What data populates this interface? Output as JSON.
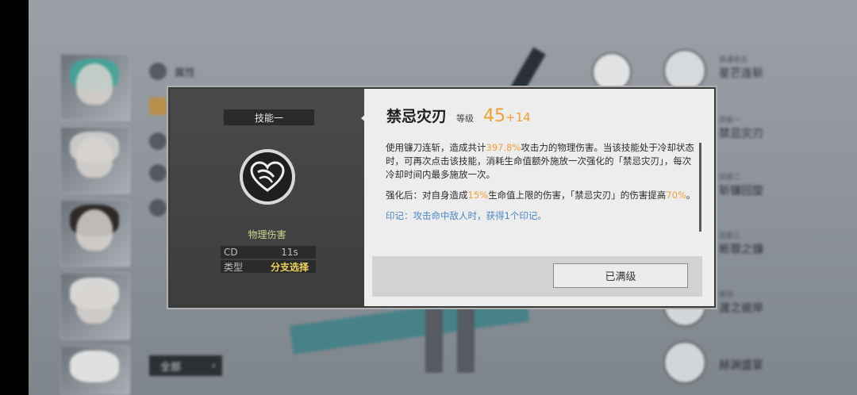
{
  "background": {
    "side_menu": [
      "属性",
      "",
      "",
      "",
      ""
    ],
    "all_button": "全部",
    "right_items": [
      {
        "tier": "普通攻击",
        "name": "星芒连斩"
      },
      {
        "tier": "技能一",
        "name": "禁忌灾刃"
      },
      {
        "tier": "技能二",
        "name": "斩镰回旋"
      },
      {
        "tier": "技能三",
        "name": "断罪之镰"
      },
      {
        "tier": "被动",
        "name": "渡之彼岸"
      },
      {
        "tier": "",
        "name": "赫渊盛宴"
      }
    ]
  },
  "modal": {
    "skill_slot": "技能一",
    "damage_type": "物理伤害",
    "stats": [
      {
        "key": "CD",
        "value": "11s"
      },
      {
        "key": "类型",
        "value": "分支选择"
      }
    ],
    "skill_name": "禁忌灾刃",
    "level_label": "等级",
    "level_base": "45",
    "level_bonus": "+14",
    "desc1": {
      "pre": "使用镰刀连斩，造成共计",
      "hl": "397.8%",
      "post": "攻击力的物理伤害。当该技能处于冷却状态时，可再次点击该技能，消耗生命值额外施放一次强化的「禁忌灾刃」，每次冷却时间内最多施放一次。"
    },
    "desc2": {
      "pre": "强化后：对自身造成",
      "hl1": "15%",
      "mid": "生命值上限的伤害，「禁忌灾刃」的伤害提高",
      "hl2": "70%",
      "post": "。"
    },
    "desc3": "印记：攻击命中敌人时，获得1个印记。",
    "max_button": "已满级"
  },
  "colors": {
    "accent_orange": "#f0a030",
    "damage_type_green": "#c7d68c",
    "type_highlight": "#f2d45a",
    "mark_blue": "#4a86c5"
  }
}
